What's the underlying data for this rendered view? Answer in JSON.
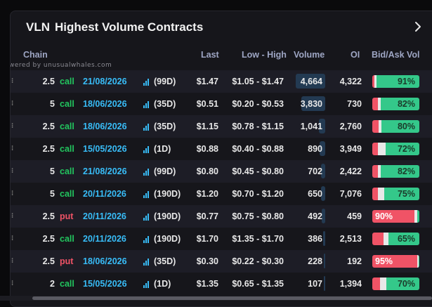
{
  "header": {
    "ticker": "VLN",
    "title": "Highest Volume Contracts"
  },
  "watermark": "owered by unusualwhales.com",
  "columns": {
    "chain": "Chain",
    "last": "Last",
    "low_high": "Low - High",
    "volume": "Volume",
    "oi": "OI",
    "bid_ask": "Bid/Ask Vol"
  },
  "colors": {
    "call": "#22c55e",
    "put": "#f05366",
    "date": "#38bdf8",
    "ask_fill": "#34c88a",
    "bid_fill": "#f05366",
    "mid_fill": "#e8e8e8",
    "volume_bar": "#233a52"
  },
  "rows": [
    {
      "strike": "2.5",
      "type": "call",
      "date": "21/08/2026",
      "dte": "(99D)",
      "last": "$1.47",
      "range": "$1.05 - $1.47",
      "volume": "4,664",
      "oi": "4,322",
      "ba_label": "91%",
      "side": "ask",
      "vol_frac": 1.0,
      "bid_frac": 0.05,
      "mid_frac": 0.04
    },
    {
      "strike": "5",
      "type": "call",
      "date": "18/06/2026",
      "dte": "(35D)",
      "last": "$0.51",
      "range": "$0.20 - $0.53",
      "volume": "3,830",
      "oi": "730",
      "ba_label": "82%",
      "side": "ask",
      "vol_frac": 0.82,
      "bid_frac": 0.12,
      "mid_frac": 0.06
    },
    {
      "strike": "2.5",
      "type": "call",
      "date": "18/06/2026",
      "dte": "(35D)",
      "last": "$1.15",
      "range": "$0.78 - $1.15",
      "volume": "1,041",
      "oi": "2,760",
      "ba_label": "80%",
      "side": "ask",
      "vol_frac": 0.22,
      "bid_frac": 0.14,
      "mid_frac": 0.06
    },
    {
      "strike": "2.5",
      "type": "call",
      "date": "15/05/2026",
      "dte": "(1D)",
      "last": "$0.88",
      "range": "$0.40 - $0.88",
      "volume": "890",
      "oi": "3,949",
      "ba_label": "72%",
      "side": "ask",
      "vol_frac": 0.19,
      "bid_frac": 0.12,
      "mid_frac": 0.16
    },
    {
      "strike": "5",
      "type": "call",
      "date": "21/08/2026",
      "dte": "(99D)",
      "last": "$0.80",
      "range": "$0.45 - $0.80",
      "volume": "702",
      "oi": "2,422",
      "ba_label": "82%",
      "side": "ask",
      "vol_frac": 0.15,
      "bid_frac": 0.12,
      "mid_frac": 0.06
    },
    {
      "strike": "5",
      "type": "call",
      "date": "20/11/2026",
      "dte": "(190D)",
      "last": "$1.20",
      "range": "$0.70 - $1.20",
      "volume": "650",
      "oi": "7,076",
      "ba_label": "75%",
      "side": "ask",
      "vol_frac": 0.14,
      "bid_frac": 0.12,
      "mid_frac": 0.13
    },
    {
      "strike": "2.5",
      "type": "put",
      "date": "20/11/2026",
      "dte": "(190D)",
      "last": "$0.77",
      "range": "$0.75 - $0.80",
      "volume": "492",
      "oi": "459",
      "ba_label": "90%",
      "side": "bid",
      "vol_frac": 0.11,
      "bid_frac": 0.9,
      "mid_frac": 0.05
    },
    {
      "strike": "2.5",
      "type": "call",
      "date": "20/11/2026",
      "dte": "(190D)",
      "last": "$1.70",
      "range": "$1.35 - $1.70",
      "volume": "386",
      "oi": "2,513",
      "ba_label": "65%",
      "side": "ask",
      "vol_frac": 0.08,
      "bid_frac": 0.24,
      "mid_frac": 0.11
    },
    {
      "strike": "2.5",
      "type": "put",
      "date": "18/06/2026",
      "dte": "(35D)",
      "last": "$0.30",
      "range": "$0.22 - $0.30",
      "volume": "228",
      "oi": "192",
      "ba_label": "95%",
      "side": "bid",
      "vol_frac": 0.05,
      "bid_frac": 0.95,
      "mid_frac": 0.03
    },
    {
      "strike": "2",
      "type": "call",
      "date": "15/05/2026",
      "dte": "(1D)",
      "last": "$1.35",
      "range": "$0.65 - $1.35",
      "volume": "107",
      "oi": "1,394",
      "ba_label": "70%",
      "side": "ask",
      "vol_frac": 0.02,
      "bid_frac": 0.16,
      "mid_frac": 0.14
    }
  ]
}
